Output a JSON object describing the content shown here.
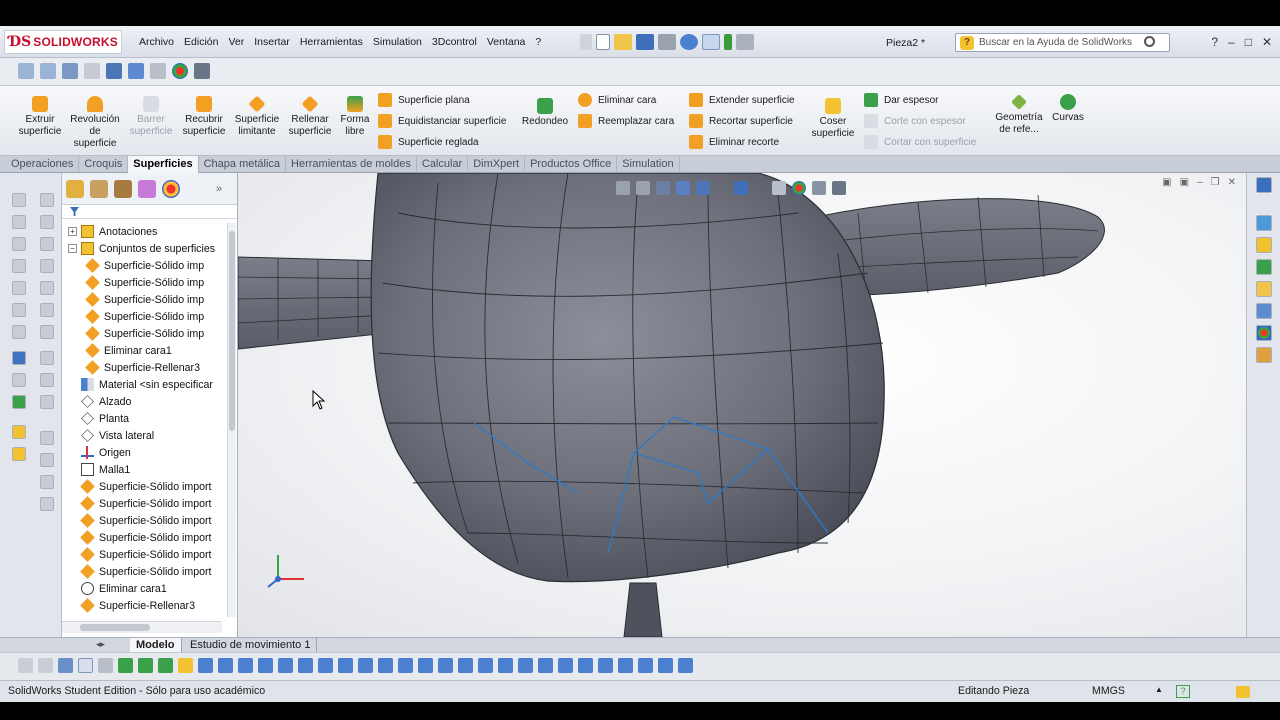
{
  "app": {
    "logo_text": "SOLIDWORKS",
    "document_title": "Pieza2 *",
    "menu": [
      "Archivo",
      "Edición",
      "Ver",
      "Insertar",
      "Herramientas",
      "Simulation",
      "3Dcontrol",
      "Ventana",
      "?"
    ],
    "help_search_placeholder": "Buscar en la Ayuda de SolidWorks",
    "window_controls": [
      "?",
      "–",
      "□",
      "✕"
    ]
  },
  "command_manager": {
    "large_buttons": [
      {
        "label": "Extruir\nsuperficie",
        "enabled": true
      },
      {
        "label": "Revolución\nde\nsuperficie",
        "enabled": true
      },
      {
        "label": "Barrer\nsuperficie",
        "enabled": false
      },
      {
        "label": "Recubrir\nsuperficie",
        "enabled": true
      },
      {
        "label": "Superficie\nlimitante",
        "enabled": true
      },
      {
        "label": "Rellenar\nsuperficie",
        "enabled": true
      },
      {
        "label": "Forma\nlibre",
        "enabled": true
      }
    ],
    "group1": [
      "Superficie plana",
      "Equidistanciar superficie",
      "Superficie reglada"
    ],
    "redondeo": "Redondeo",
    "group2": [
      "Eliminar cara",
      "Reemplazar cara"
    ],
    "group3": [
      "Extender superficie",
      "Recortar superficie",
      "Eliminar recorte"
    ],
    "coser": "Coser\nsuperficie",
    "group4": [
      {
        "label": "Dar espesor",
        "enabled": true
      },
      {
        "label": "Corte con espesor",
        "enabled": false
      },
      {
        "label": "Cortar con superficie",
        "enabled": false
      }
    ],
    "geometria": "Geometría\nde refe...",
    "curvas": "Curvas"
  },
  "tabs": [
    {
      "label": "Operaciones",
      "active": false
    },
    {
      "label": "Croquis",
      "active": false
    },
    {
      "label": "Superficies",
      "active": true
    },
    {
      "label": "Chapa metálica",
      "active": false
    },
    {
      "label": "Herramientas de moldes",
      "active": false
    },
    {
      "label": "Calcular",
      "active": false
    },
    {
      "label": "DimXpert",
      "active": false
    },
    {
      "label": "Productos Office",
      "active": false
    },
    {
      "label": "Simulation",
      "active": false
    }
  ],
  "feature_tree": {
    "items": [
      {
        "label": "Anotaciones",
        "level": 0,
        "icon": "annotation-icon",
        "expander": "+"
      },
      {
        "label": "Conjuntos de superficies",
        "level": 0,
        "icon": "surface-bodies-icon",
        "expander": "−"
      },
      {
        "label": "Superficie-Sólido imp",
        "level": 1,
        "icon": "surface-icon"
      },
      {
        "label": "Superficie-Sólido imp",
        "level": 1,
        "icon": "surface-icon"
      },
      {
        "label": "Superficie-Sólido imp",
        "level": 1,
        "icon": "surface-icon"
      },
      {
        "label": "Superficie-Sólido imp",
        "level": 1,
        "icon": "surface-icon"
      },
      {
        "label": "Superficie-Sólido imp",
        "level": 1,
        "icon": "surface-icon"
      },
      {
        "label": "Eliminar cara1",
        "level": 1,
        "icon": "surface-icon"
      },
      {
        "label": "Superficie-Rellenar3",
        "level": 1,
        "icon": "surface-icon"
      },
      {
        "label": "Material <sin especificar",
        "level": 0,
        "icon": "material-icon"
      },
      {
        "label": "Alzado",
        "level": 0,
        "icon": "plane-icon"
      },
      {
        "label": "Planta",
        "level": 0,
        "icon": "plane-icon"
      },
      {
        "label": "Vista lateral",
        "level": 0,
        "icon": "plane-icon"
      },
      {
        "label": "Origen",
        "level": 0,
        "icon": "origin-icon"
      },
      {
        "label": "Malla1",
        "level": 0,
        "icon": "mesh-icon"
      },
      {
        "label": "Superficie-Sólido import",
        "level": 0,
        "icon": "surface-icon"
      },
      {
        "label": "Superficie-Sólido import",
        "level": 0,
        "icon": "surface-icon"
      },
      {
        "label": "Superficie-Sólido import",
        "level": 0,
        "icon": "surface-icon"
      },
      {
        "label": "Superficie-Sólido import",
        "level": 0,
        "icon": "surface-icon"
      },
      {
        "label": "Superficie-Sólido import",
        "level": 0,
        "icon": "surface-icon"
      },
      {
        "label": "Superficie-Sólido import",
        "level": 0,
        "icon": "surface-icon"
      },
      {
        "label": "Eliminar cara1",
        "level": 0,
        "icon": "delete-face-icon"
      },
      {
        "label": "Superficie-Rellenar3",
        "level": 0,
        "icon": "surface-icon"
      }
    ]
  },
  "bottom_tabs": [
    {
      "label": "Modelo",
      "active": true
    },
    {
      "label": "Estudio de movimiento 1",
      "active": false
    }
  ],
  "status": {
    "left": "SolidWorks Student Edition - Sólo para uso académico",
    "mode": "Editando Pieza",
    "units": "MMGS",
    "help": "?"
  },
  "colors": {
    "surface_icon": "#f2a024",
    "model_gray": "#6d707b",
    "selection_edge": "#2e79c7",
    "brand_red": "#c8102e"
  }
}
